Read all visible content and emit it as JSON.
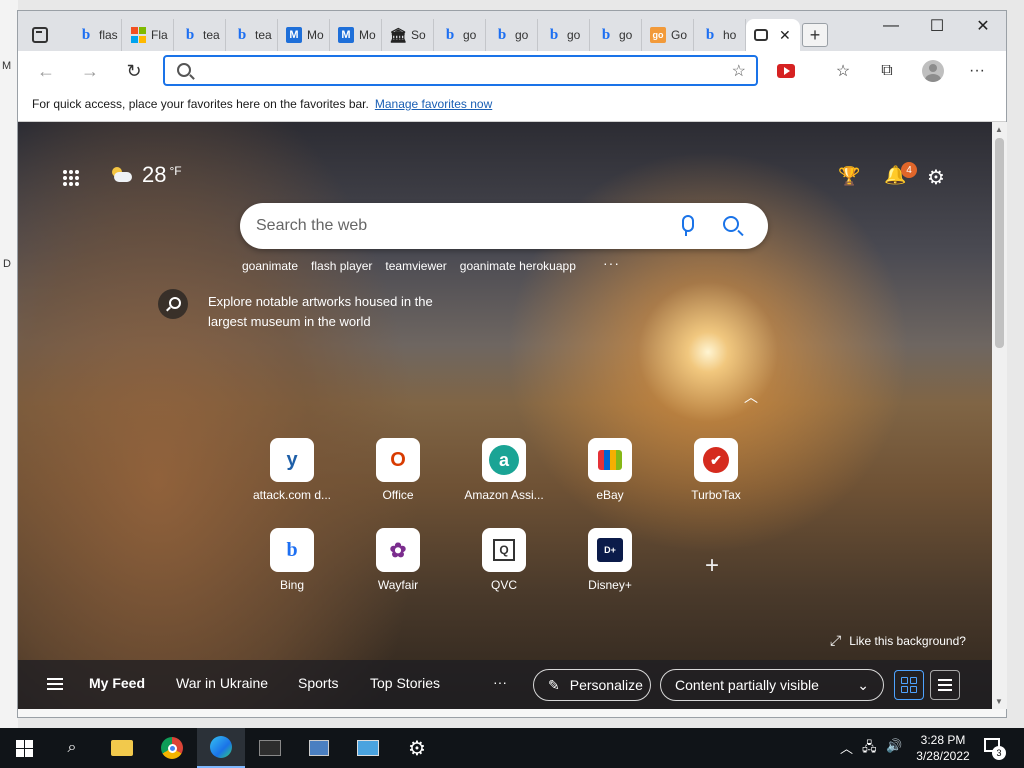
{
  "desktop": {
    "left_letter_1": "M",
    "left_letter_2": "D"
  },
  "tabs": [
    {
      "label": "flas",
      "icon": "bing-icon"
    },
    {
      "label": "Fla",
      "icon": "microsoft-icon"
    },
    {
      "label": "tea",
      "icon": "bing-icon"
    },
    {
      "label": "tea",
      "icon": "bing-icon"
    },
    {
      "label": "Mo",
      "icon": "m-icon"
    },
    {
      "label": "Mo",
      "icon": "m-icon"
    },
    {
      "label": "So",
      "icon": "pillar-icon"
    },
    {
      "label": "go",
      "icon": "bing-icon"
    },
    {
      "label": "go",
      "icon": "bing-icon"
    },
    {
      "label": "go",
      "icon": "bing-icon"
    },
    {
      "label": "go",
      "icon": "bing-icon"
    },
    {
      "label": "Go",
      "icon": "goanimate-icon"
    },
    {
      "label": "ho",
      "icon": "bing-icon"
    }
  ],
  "address_bar": {
    "value": "",
    "placeholder": ""
  },
  "favorites_bar": {
    "message": "For quick access, place your favorites here on the favorites bar.",
    "link": "Manage favorites now"
  },
  "ntp": {
    "weather": {
      "temp": "28",
      "unit": "°F"
    },
    "notifications_count": "4",
    "search_placeholder": "Search the web",
    "trending": [
      "goanimate",
      "flash player",
      "teamviewer",
      "goanimate herokuapp"
    ],
    "explore_text": "Explore notable artworks housed in the largest museum in the world",
    "tiles": [
      {
        "label": "attack.com d...",
        "glyph": "y",
        "color": "#1e5fa8"
      },
      {
        "label": "Office",
        "glyph": "O",
        "color": "#d83b01"
      },
      {
        "label": "Amazon Assi...",
        "glyph": "a",
        "color": "#ffffff"
      },
      {
        "label": "eBay",
        "glyph": "🛍",
        "color": "#222222"
      },
      {
        "label": "TurboTax",
        "glyph": "✔",
        "color": "#ffffff"
      },
      {
        "label": "Bing",
        "glyph": "b",
        "color": "#1d6ff2"
      },
      {
        "label": "Wayfair",
        "glyph": "✿",
        "color": "#7b2d8e"
      },
      {
        "label": "QVC",
        "glyph": "Q",
        "color": "#333333"
      },
      {
        "label": "Disney+",
        "glyph": "D+",
        "color": "#ffffff"
      }
    ],
    "like_background": "Like this background?",
    "feed_tabs": [
      "My Feed",
      "War in Ukraine",
      "Sports",
      "Top Stories"
    ],
    "personalize": "Personalize",
    "content_visibility": "Content partially visible"
  },
  "taskbar": {
    "time": "3:28 PM",
    "date": "3/28/2022",
    "notification_count": "3"
  }
}
